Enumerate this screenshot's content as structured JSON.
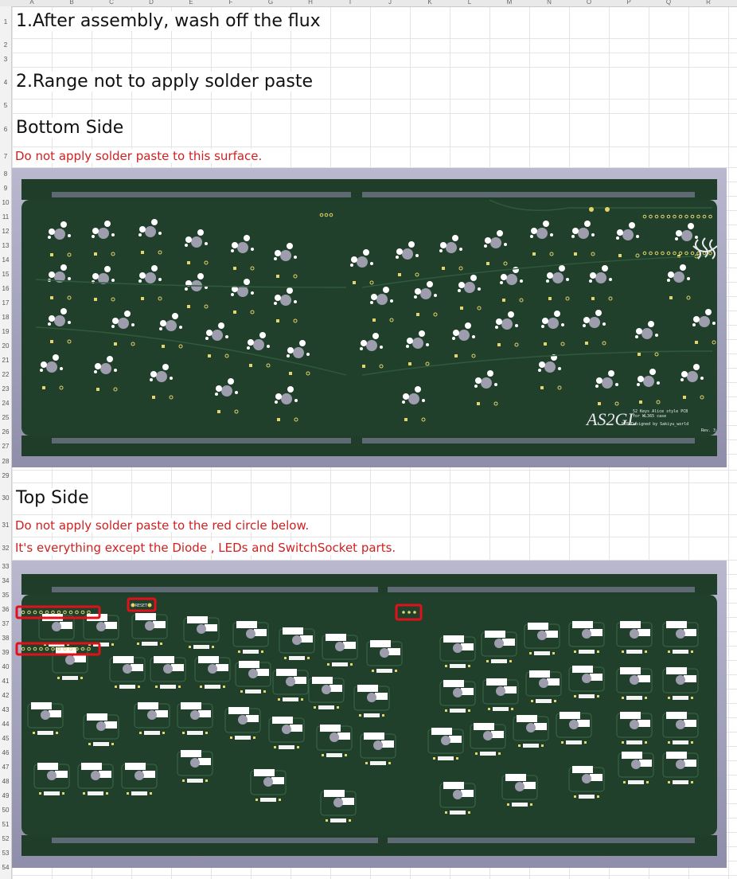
{
  "sheet": {
    "columns": [
      "A",
      "B",
      "C",
      "D",
      "E",
      "F",
      "G",
      "H",
      "I",
      "J",
      "K",
      "L",
      "M",
      "N",
      "O",
      "P",
      "Q",
      "R"
    ],
    "rows": [
      "1",
      "2",
      "3",
      "4",
      "5",
      "6",
      "7",
      "8",
      "9",
      "10",
      "11",
      "12",
      "13",
      "14",
      "15",
      "16",
      "17",
      "18",
      "19",
      "20",
      "21",
      "22",
      "23",
      "24",
      "25",
      "26",
      "27",
      "28",
      "29",
      "30",
      "31",
      "32",
      "33",
      "34",
      "35",
      "36",
      "37",
      "38",
      "39",
      "40",
      "41",
      "42",
      "43",
      "44",
      "45",
      "46",
      "47",
      "48",
      "49",
      "50",
      "51",
      "52",
      "53",
      "54"
    ]
  },
  "content": {
    "step1": "1.After assembly, wash off the flux",
    "step2": "2.Range not to apply solder paste",
    "bottom_heading": "Bottom Side",
    "bottom_note": "Do not apply solder paste to this surface.",
    "top_heading": "Top Side",
    "top_note_1": "Do not apply solder paste to the red circle below.",
    "top_note_2": "It's everything except the Diode , LEDs and SwitchSocket parts."
  },
  "bottom_pcb": {
    "logo": "AS2GL",
    "line1": "52 Keys Alice style PCB",
    "line2": "for WL365 case",
    "designer": "PCB Designed by Sakiyu_world",
    "rev": "Rev. 3"
  },
  "top_pcb": {
    "reset_label": "RESET"
  },
  "colors": {
    "pcb_green": "#1f3d29",
    "highlight_red": "#e0111a",
    "frame": "#a9a8c2"
  }
}
